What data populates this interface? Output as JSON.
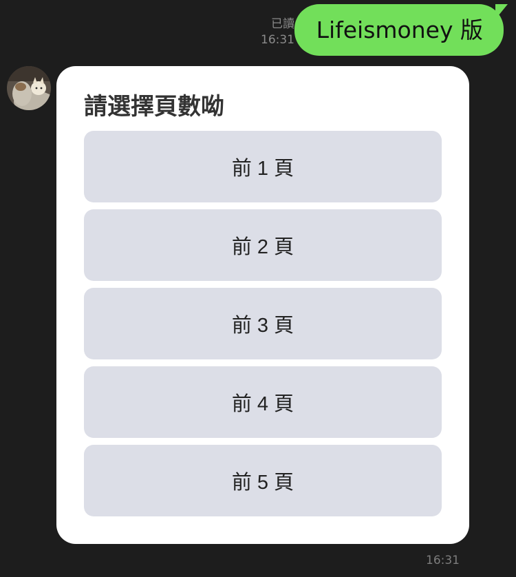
{
  "outgoing": {
    "read_status": "已讀",
    "time": "16:31",
    "text": "Lifeismoney 版"
  },
  "incoming": {
    "title": "請選擇頁數呦",
    "options": [
      "前 1 頁",
      "前 2 頁",
      "前 3 頁",
      "前 4 頁",
      "前 5 頁"
    ],
    "time": "16:31"
  },
  "colors": {
    "background": "#1d1d1d",
    "outgoing_bubble": "#72df5a",
    "option_button": "#dcdee7",
    "card": "#ffffff"
  },
  "icons": {
    "avatar": "cat-photo-avatar"
  }
}
